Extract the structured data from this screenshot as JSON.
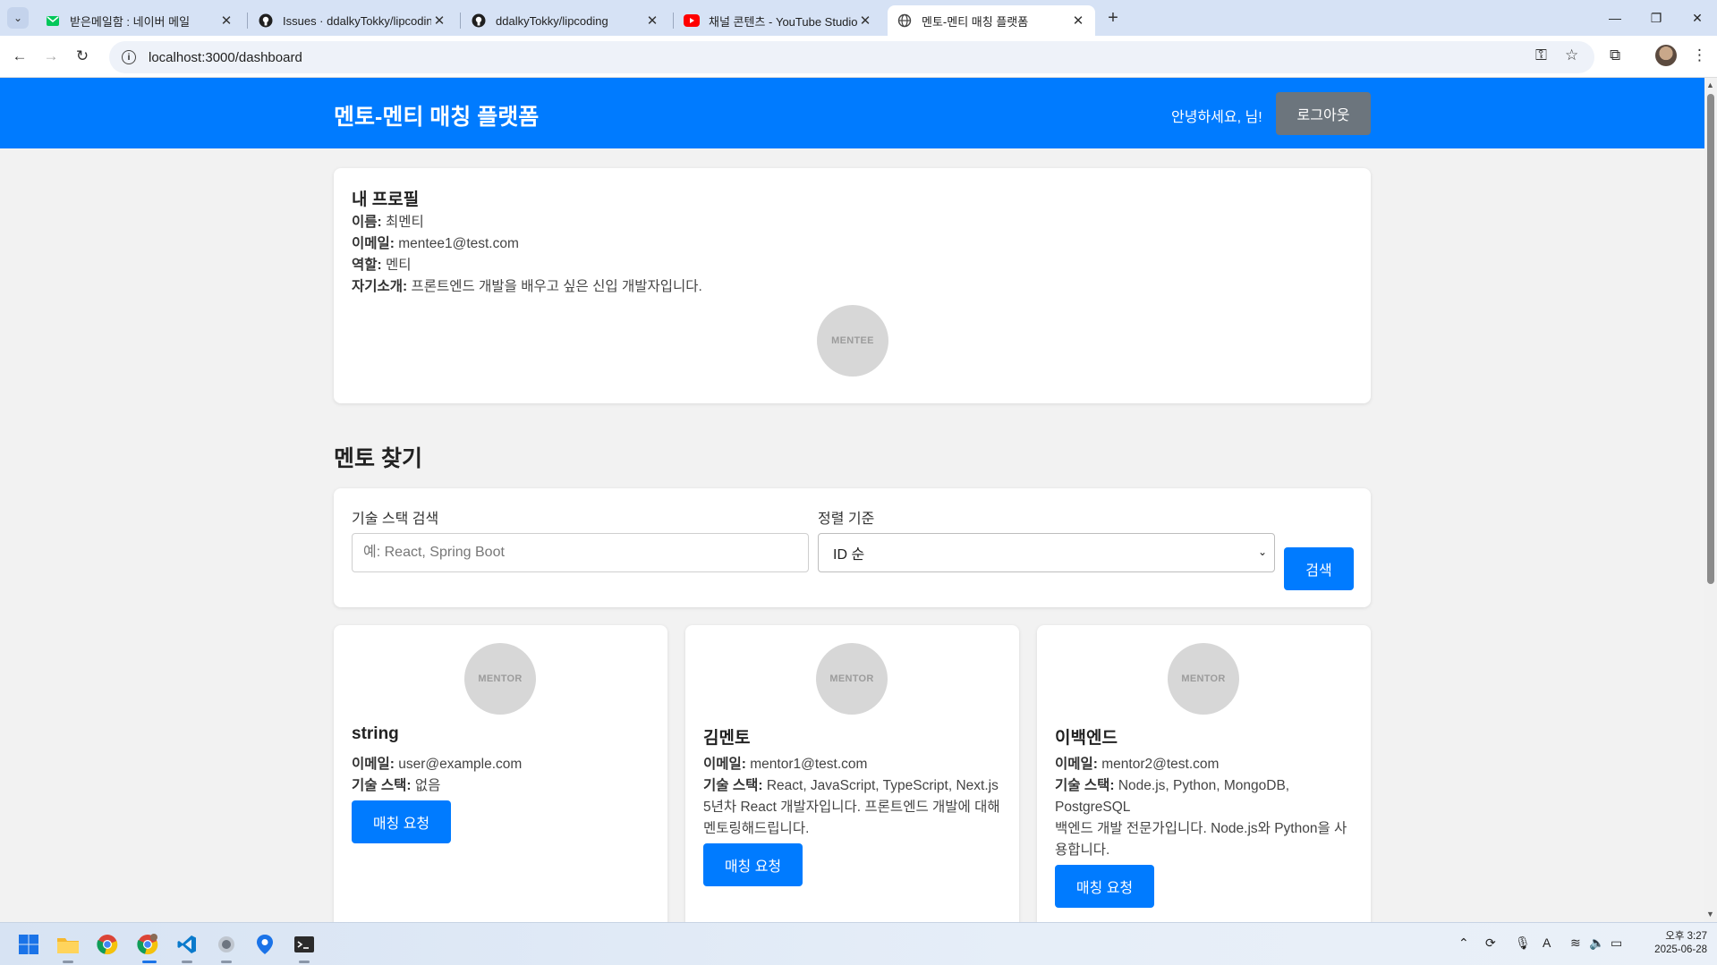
{
  "browser": {
    "tabs": [
      {
        "title": "받은메일함 : 네이버 메일",
        "icon": "naver-mail-icon"
      },
      {
        "title": "Issues · ddalkyTokky/lipcoding",
        "icon": "github-icon"
      },
      {
        "title": "ddalkyTokky/lipcoding",
        "icon": "github-icon"
      },
      {
        "title": "채널 콘텐츠 - YouTube Studio",
        "icon": "youtube-icon"
      },
      {
        "title": "멘토-멘티 매칭 플랫폼",
        "icon": "globe-icon"
      }
    ],
    "active_tab": 4,
    "url": "localhost:3000/dashboard"
  },
  "header": {
    "title": "멘토-멘티 매칭 플랫폼",
    "greeting": "안녕하세요, 님!",
    "logout_label": "로그아웃"
  },
  "profile": {
    "heading": "내 프로필",
    "name_label": "이름:",
    "name": "최멘티",
    "email_label": "이메일:",
    "email": "mentee1@test.com",
    "role_label": "역할:",
    "role": "멘티",
    "bio_label": "자기소개:",
    "bio": "프론트엔드 개발을 배우고 싶은 신입 개발자입니다.",
    "avatar_text": "MENTEE"
  },
  "find_mentor": {
    "heading": "멘토 찾기",
    "skill_label": "기술 스택 검색",
    "skill_placeholder": "예: React, Spring Boot",
    "sort_label": "정렬 기준",
    "sort_value": "ID 순",
    "search_label": "검색"
  },
  "mentors": [
    {
      "avatar_text": "MENTOR",
      "name": "string",
      "email_label": "이메일:",
      "email": "user@example.com",
      "skills_label": "기술 스택:",
      "skills": "없음",
      "intro": "",
      "request_label": "매칭 요청"
    },
    {
      "avatar_text": "MENTOR",
      "name": "김멘토",
      "email_label": "이메일:",
      "email": "mentor1@test.com",
      "skills_label": "기술 스택:",
      "skills": "React, JavaScript, TypeScript, Next.js",
      "intro": "5년차 React 개발자입니다. 프론트엔드 개발에 대해 멘토링해드립니다.",
      "request_label": "매칭 요청"
    },
    {
      "avatar_text": "MENTOR",
      "name": "이백엔드",
      "email_label": "이메일:",
      "email": "mentor2@test.com",
      "skills_label": "기술 스택:",
      "skills": "Node.js, Python, MongoDB, PostgreSQL",
      "intro": "백엔드 개발 전문가입니다. Node.js와 Python을 사용합니다.",
      "request_label": "매칭 요청"
    }
  ],
  "taskbar": {
    "apps": [
      "windows-start-icon",
      "file-explorer-icon",
      "chrome-icon",
      "chrome-profile-icon",
      "vscode-icon",
      "app-icon",
      "maps-icon",
      "terminal-icon"
    ],
    "time": "오후 3:27",
    "date": "2025-06-28",
    "ime": "A"
  },
  "colors": {
    "primary": "#007bff",
    "logout_bg": "#6c757d",
    "page_bg": "#f2f2f2",
    "avatar_bg": "#d7d7d7"
  }
}
